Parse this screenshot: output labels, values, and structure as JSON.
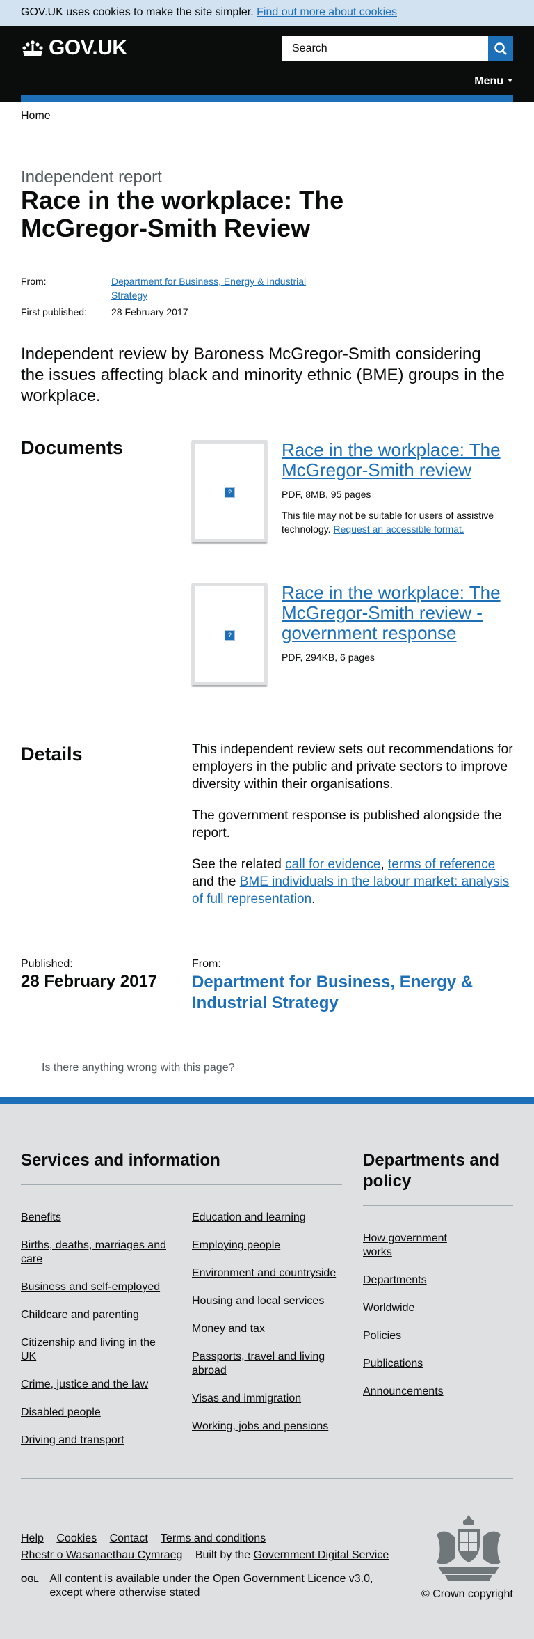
{
  "cookie_banner": {
    "text": "GOV.UK uses cookies to make the site simpler.",
    "link": "Find out more about cookies"
  },
  "header": {
    "logo_text": "GOV.UK",
    "search_placeholder": "Search",
    "menu_label": "Menu",
    "accent_color": "#1d70b8"
  },
  "breadcrumb": {
    "home": "Home"
  },
  "page": {
    "caption": "Independent report",
    "title": "Race in the workplace: The McGregor-Smith Review",
    "meta": {
      "from_label": "From:",
      "from_value": "Department for Business, Energy & Industrial Strategy",
      "published_label": "First published:",
      "published_value": "28 February 2017"
    },
    "lead": "Independent review by Baroness McGregor-Smith considering the issues affecting black and minority ethnic (BME) groups in the workplace."
  },
  "documents": {
    "heading": "Documents",
    "items": [
      {
        "title": "Race in the workplace: The McGregor-Smith review",
        "meta": "PDF, 8MB, 95 pages",
        "note": "This file may not be suitable for users of assistive technology.",
        "note_link": "Request an accessible format."
      },
      {
        "title": "Race in the workplace: The McGregor-Smith review - government response",
        "meta": "PDF, 294KB, 6 pages"
      }
    ]
  },
  "details": {
    "heading": "Details",
    "p1": "This independent review sets out recommendations for employers in the public and private sectors to improve diversity within their organisations.",
    "p2": "The government response is published alongside the report.",
    "p3_prefix": "See the related",
    "p3_link1": "call for evidence",
    "p3_sep": ",",
    "p3_link2": "terms of reference",
    "p3_mid": "and the",
    "p3_link3": "BME individuals in the labour market: analysis of full representation",
    "p3_end": "."
  },
  "published": {
    "label": "Published:",
    "date": "28 February 2017",
    "from_label": "From:",
    "from_value": "Department for Business, Energy & Industrial Strategy"
  },
  "report_problem": "Is there anything wrong with this page?",
  "footer": {
    "services_heading": "Services and information",
    "services_col1": [
      "Benefits",
      "Births, deaths, marriages and care",
      "Business and self-employed",
      "Childcare and parenting",
      "Citizenship and living in the UK",
      "Crime, justice and the law",
      "Disabled people",
      "Driving and transport"
    ],
    "services_col2": [
      "Education and learning",
      "Employing people",
      "Environment and countryside",
      "Housing and local services",
      "Money and tax",
      "Passports, travel and living abroad",
      "Visas and immigration",
      "Working, jobs and pensions"
    ],
    "departments_heading": "Departments and policy",
    "departments": [
      "How government works",
      "Departments",
      "Worldwide",
      "Policies",
      "Publications",
      "Announcements"
    ],
    "meta_links": [
      "Help",
      "Cookies",
      "Contact",
      "Terms and conditions"
    ],
    "welsh": "Rhestr o Wasanaethau Cymraeg",
    "built_by_prefix": "Built by the",
    "built_by_link": "Government Digital Service",
    "ogl_logo": "OGL",
    "licence_prefix": "All content is available under the",
    "licence_link": "Open Government Licence v3.0",
    "licence_suffix": ", except where otherwise stated",
    "copyright": "© Crown copyright"
  }
}
